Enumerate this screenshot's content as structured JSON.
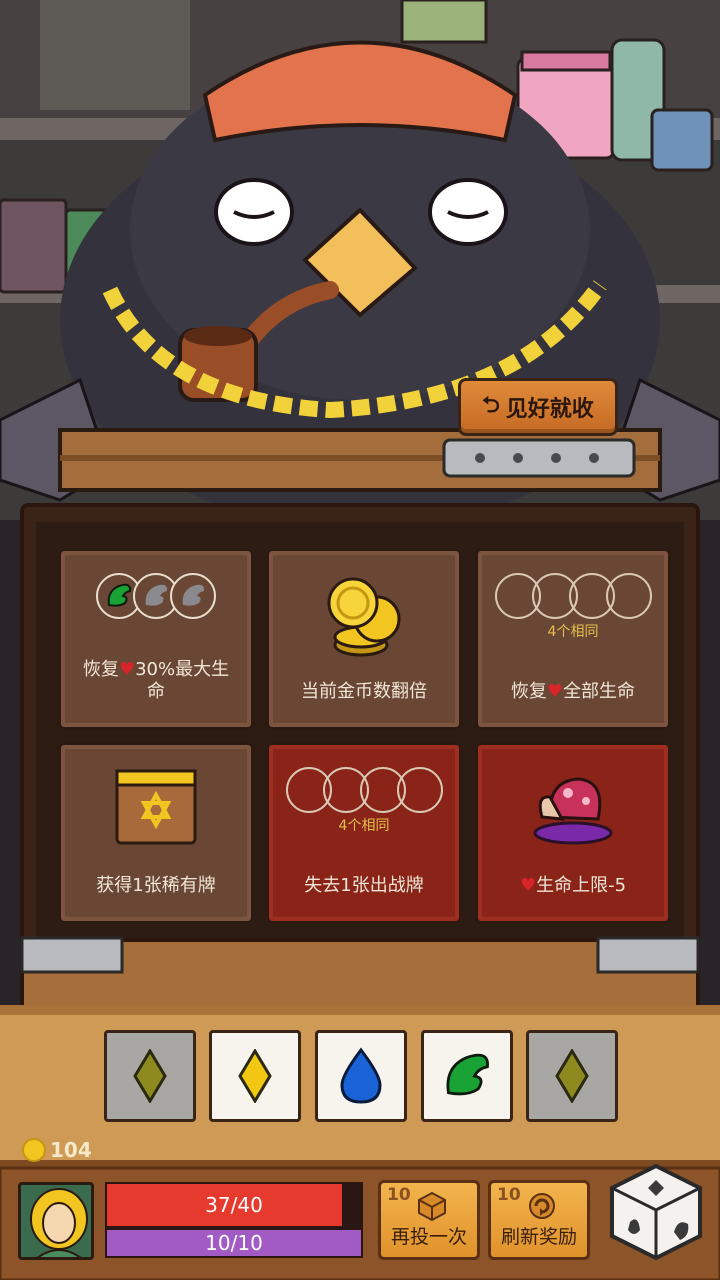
{
  "leave_button": {
    "label": "见好就收",
    "icon": "return-arrow-icon"
  },
  "prizes": [
    {
      "text_before": "恢复",
      "text_after": "30%最大生命",
      "icon": "heart-icon",
      "visual": "circles-wings",
      "tone": "brown"
    },
    {
      "text": "当前金币数翻倍",
      "visual": "coin-stack",
      "tone": "brown"
    },
    {
      "text_before": "恢复",
      "text_after": "全部生命",
      "sub": "4个相同",
      "icon": "heart-icon",
      "visual": "circles-empty",
      "tone": "brown"
    },
    {
      "text": "获得1张稀有牌",
      "visual": "rare-card",
      "tone": "brown"
    },
    {
      "text": "失去1张出战牌",
      "sub": "4个相同",
      "visual": "circles-empty",
      "tone": "red"
    },
    {
      "text": "生命上限-5",
      "icon": "heart-icon",
      "visual": "mushroom",
      "tone": "red"
    }
  ],
  "dice_slots": [
    {
      "symbol": "diamond",
      "color": "#8f8a20",
      "active": false
    },
    {
      "symbol": "diamond",
      "color": "#f1c712",
      "active": true
    },
    {
      "symbol": "drop",
      "color": "#1a63d6",
      "active": true
    },
    {
      "symbol": "wing",
      "color": "#19a334",
      "active": true
    },
    {
      "symbol": "diamond",
      "color": "#8f8a20",
      "active": false
    }
  ],
  "hud": {
    "coins": "104",
    "hp_text": "37/40",
    "hp_ratio": 0.925,
    "mp_text": "10/10",
    "mp_ratio": 1.0,
    "reroll": {
      "cost": "10",
      "label": "再投一次",
      "icon": "die-icon"
    },
    "refresh": {
      "cost": "10",
      "label": "刷新奖励",
      "icon": "refresh-icon"
    }
  },
  "colors": {
    "hp": "#e63a2e",
    "mp": "#a25bc4",
    "panel_brown": "#6a4634",
    "panel_red": "#8a2418",
    "gold": "#f2c521"
  }
}
